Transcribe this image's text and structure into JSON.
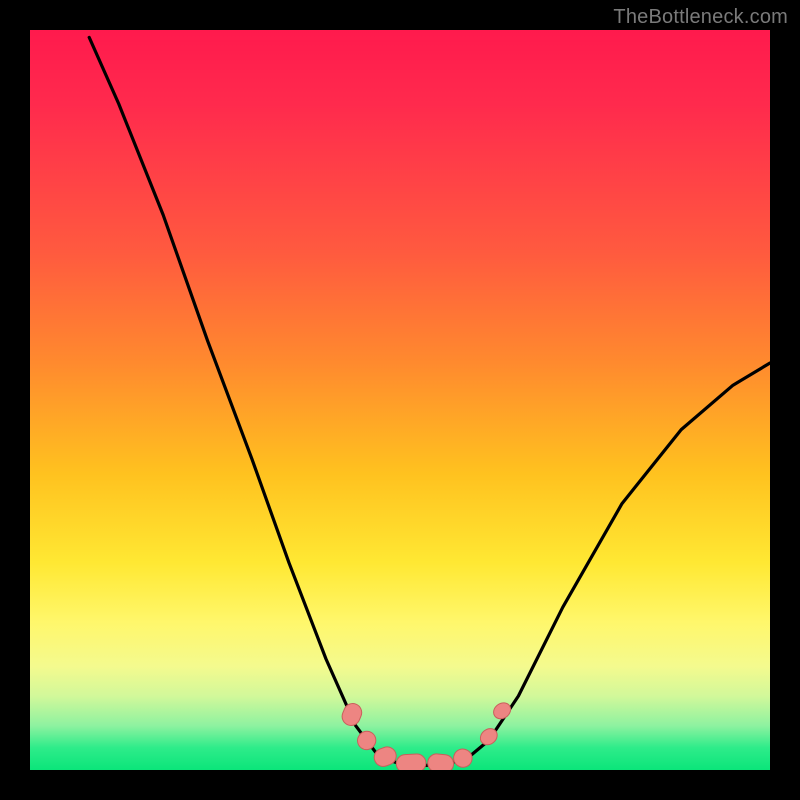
{
  "watermark": "TheBottleneck.com",
  "colors": {
    "curve": "#000000",
    "marker_fill": "#ed8582",
    "marker_stroke": "#c95f5c",
    "background_black": "#000000"
  },
  "chart_data": {
    "type": "line",
    "title": "",
    "xlabel": "",
    "ylabel": "",
    "xlim": [
      0,
      100
    ],
    "ylim": [
      0,
      100
    ],
    "note": "Axes unlabeled; values are relative positions (0–100) estimated from pixel coordinates. Low y ≈ bottom (green / good), high y ≈ top (red / bad). Curve resembles a bottleneck V-shape.",
    "series": [
      {
        "name": "bottleneck-curve",
        "points": [
          {
            "x": 8.0,
            "y": 99.0
          },
          {
            "x": 12.0,
            "y": 90.0
          },
          {
            "x": 18.0,
            "y": 75.0
          },
          {
            "x": 24.0,
            "y": 58.0
          },
          {
            "x": 30.0,
            "y": 42.0
          },
          {
            "x": 35.0,
            "y": 28.0
          },
          {
            "x": 40.0,
            "y": 15.0
          },
          {
            "x": 44.0,
            "y": 6.0
          },
          {
            "x": 47.0,
            "y": 2.0
          },
          {
            "x": 50.0,
            "y": 0.8
          },
          {
            "x": 53.0,
            "y": 0.6
          },
          {
            "x": 56.0,
            "y": 0.8
          },
          {
            "x": 59.0,
            "y": 1.5
          },
          {
            "x": 62.0,
            "y": 4.0
          },
          {
            "x": 66.0,
            "y": 10.0
          },
          {
            "x": 72.0,
            "y": 22.0
          },
          {
            "x": 80.0,
            "y": 36.0
          },
          {
            "x": 88.0,
            "y": 46.0
          },
          {
            "x": 95.0,
            "y": 52.0
          },
          {
            "x": 100.0,
            "y": 55.0
          }
        ]
      }
    ],
    "markers": {
      "name": "highlighted-segments",
      "style": "rounded-capsule",
      "points": [
        {
          "x": 43.5,
          "y": 7.5,
          "len": 3.0,
          "angle": -68
        },
        {
          "x": 45.5,
          "y": 4.0,
          "len": 2.5,
          "angle": -55
        },
        {
          "x": 48.0,
          "y": 1.8,
          "len": 3.0,
          "angle": -20
        },
        {
          "x": 51.5,
          "y": 0.9,
          "len": 4.0,
          "angle": -3
        },
        {
          "x": 55.5,
          "y": 0.9,
          "len": 3.5,
          "angle": 6
        },
        {
          "x": 58.5,
          "y": 1.6,
          "len": 2.5,
          "angle": 25
        },
        {
          "x": 62.0,
          "y": 4.5,
          "len": 2.0,
          "angle": 50
        },
        {
          "x": 63.8,
          "y": 8.0,
          "len": 2.0,
          "angle": 55
        }
      ]
    }
  }
}
